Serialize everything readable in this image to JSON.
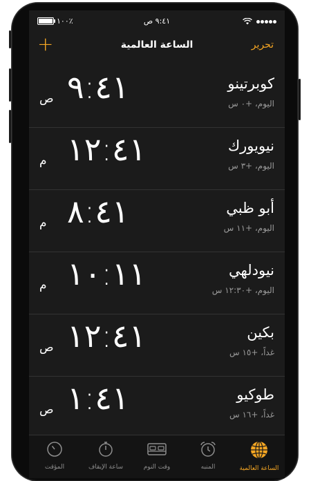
{
  "status": {
    "battery": "١٠٠٪",
    "time": "٩:٤١ ص"
  },
  "nav": {
    "add": "+",
    "title": "الساعة العالمية",
    "edit": "تحرير"
  },
  "cities": [
    {
      "name": "كوبرتينو",
      "offset": "اليوم، +٠ س",
      "time": "٩:٤١",
      "ampm": "ص"
    },
    {
      "name": "نيويورك",
      "offset": "اليوم، +٣ س",
      "time": "١٢:٤١",
      "ampm": "م"
    },
    {
      "name": "أبو ظبي",
      "offset": "اليوم، +١١ س",
      "time": "٨:٤١",
      "ampm": "م"
    },
    {
      "name": "نيودلهي",
      "offset": "اليوم، +١٢:٣٠ س",
      "time": "١٠:١١",
      "ampm": "م"
    },
    {
      "name": "بكين",
      "offset": "غداً، +١٥ س",
      "time": "١٢:٤١",
      "ampm": "ص"
    },
    {
      "name": "طوكيو",
      "offset": "غداً، +١٦ س",
      "time": "١:٤١",
      "ampm": "ص"
    }
  ],
  "tabs": [
    {
      "label": "المؤقت",
      "icon": "timer-icon"
    },
    {
      "label": "ساعة الإيقاف",
      "icon": "stopwatch-icon"
    },
    {
      "label": "وقت النوم",
      "icon": "bed-icon"
    },
    {
      "label": "المنبه",
      "icon": "alarm-clock-icon"
    },
    {
      "label": "الساعة العالمية",
      "icon": "globe-icon",
      "active": true
    }
  ],
  "colors": {
    "accent": "#f5a623",
    "tab_inactive": "#8e8e8e"
  }
}
